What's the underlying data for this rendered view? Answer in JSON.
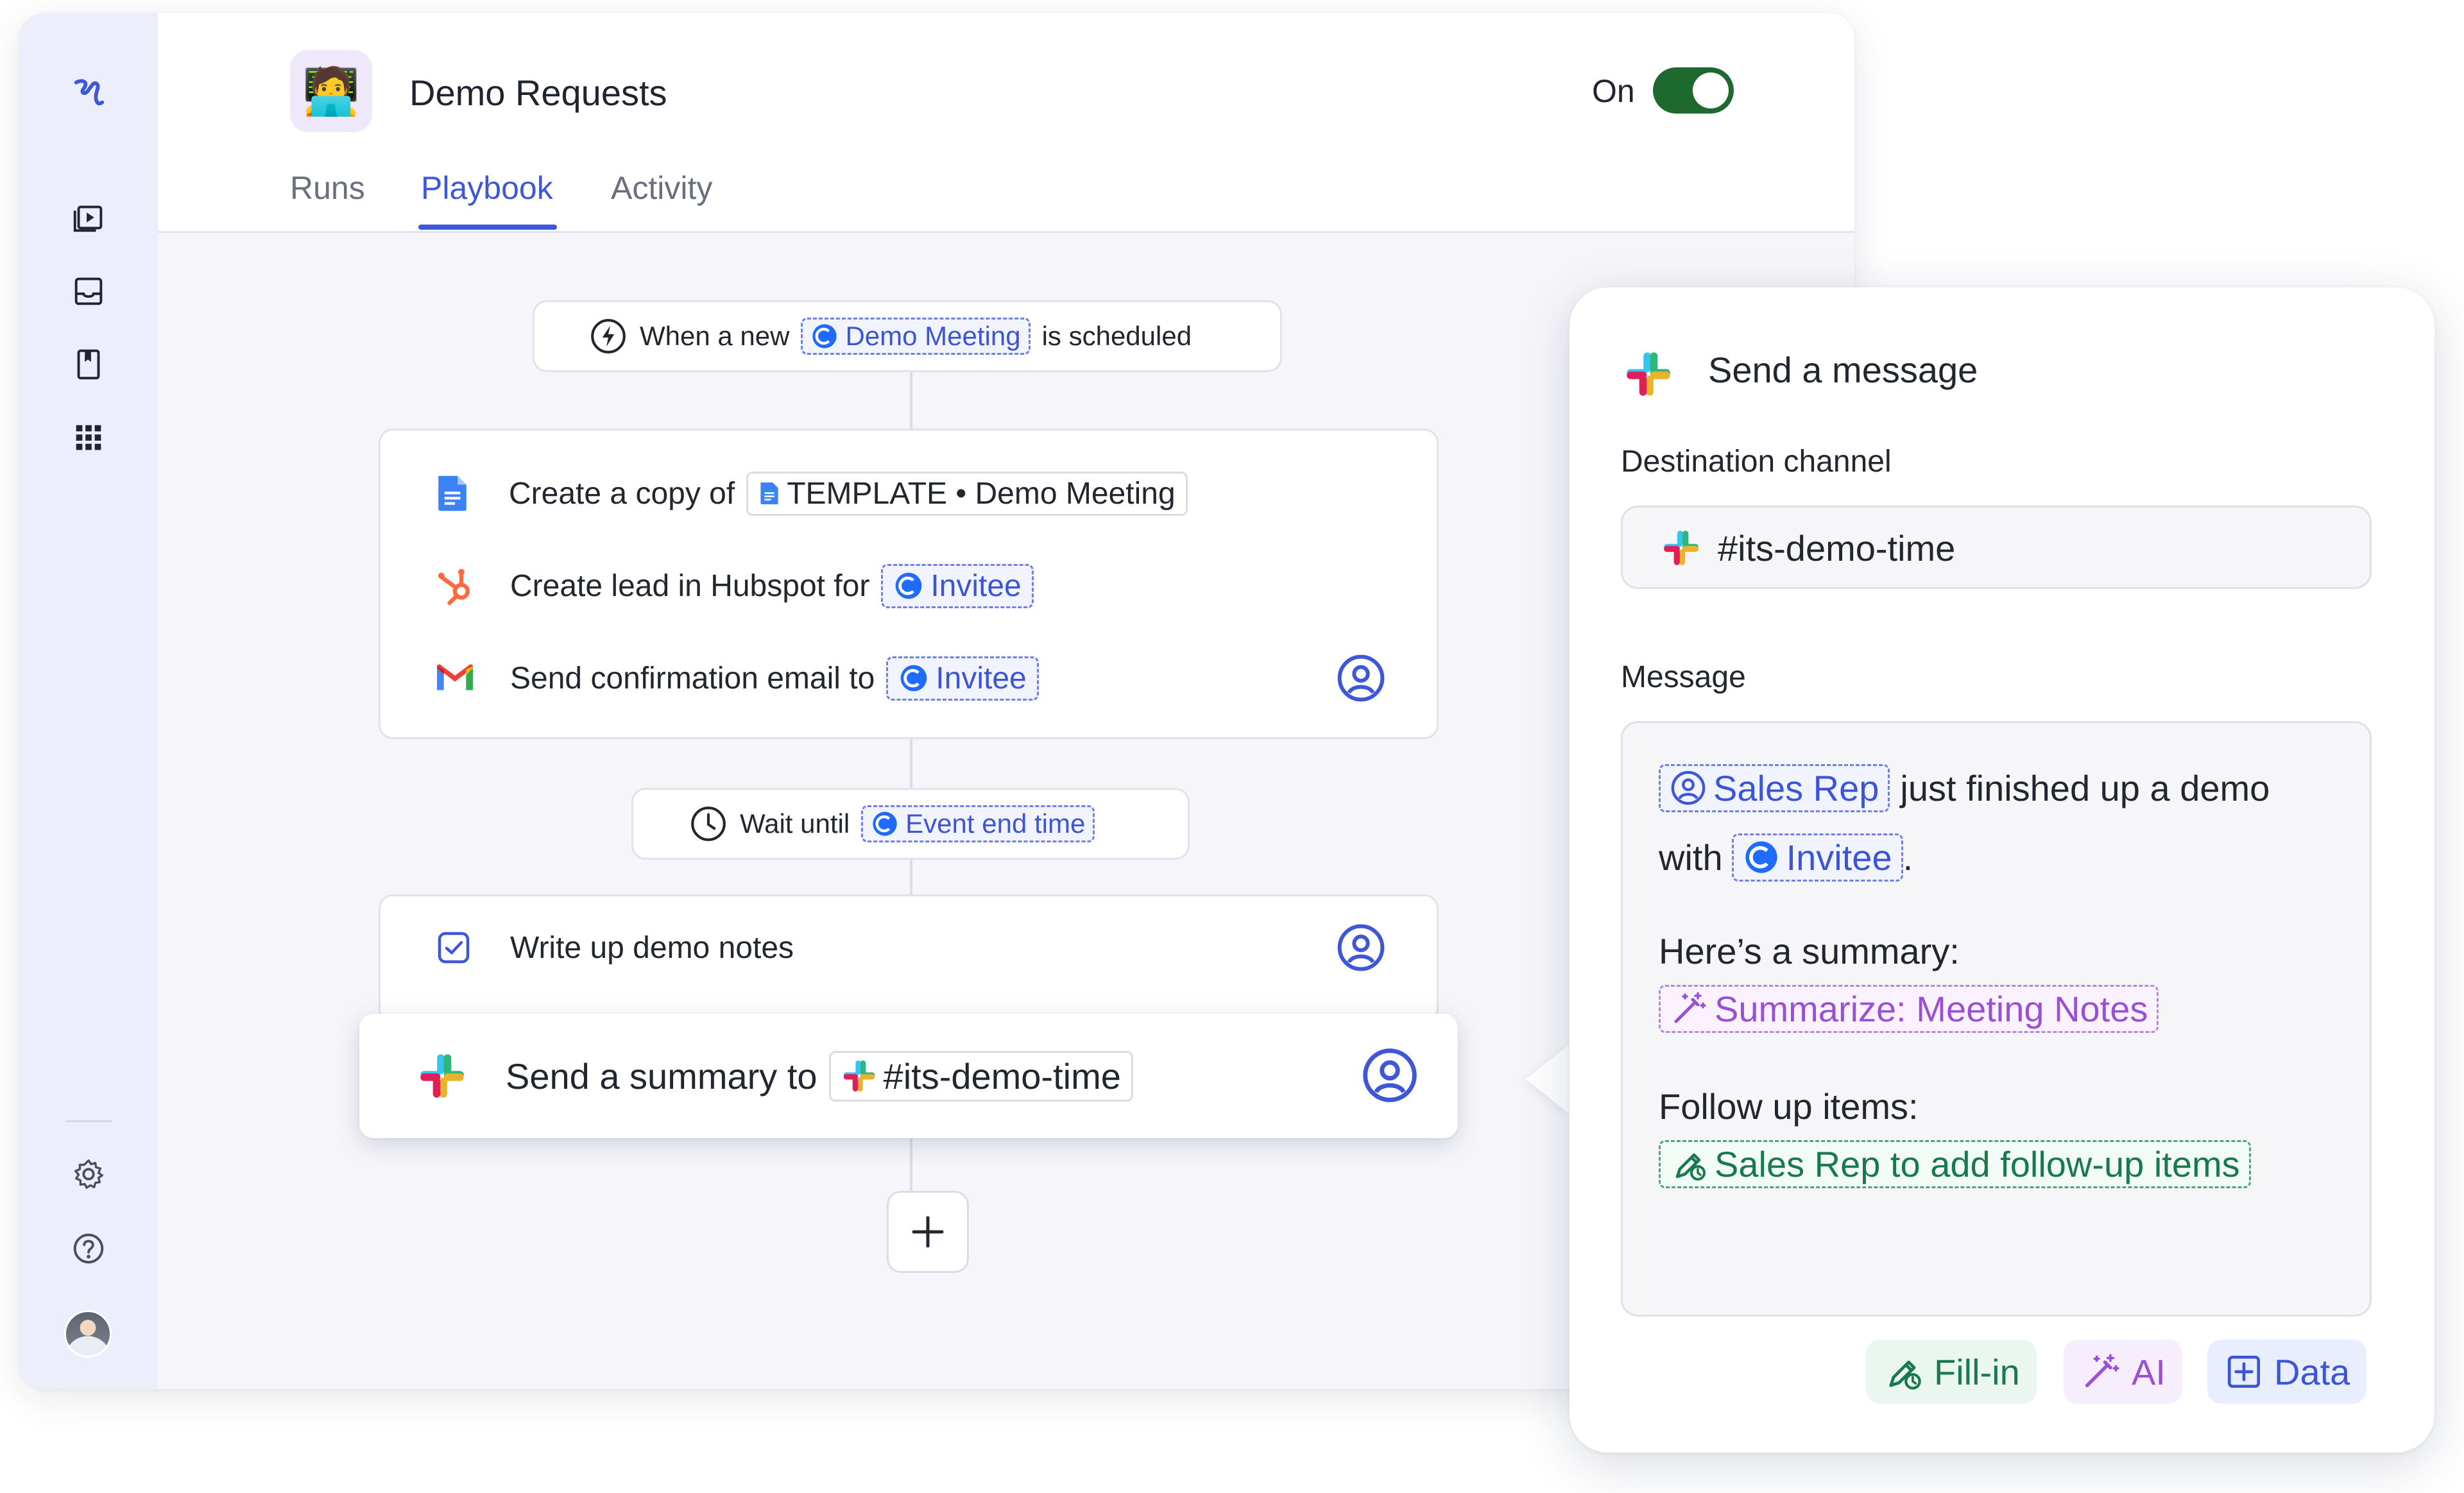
{
  "window": {
    "app_title": "Demo Requests",
    "app_icon": "technologist-emoji",
    "app_emoji": "🧑‍💻",
    "toggle_label": "On",
    "toggle_state": "on",
    "accent_color": "#3e57d8",
    "toggle_color": "#1e6a2e"
  },
  "sidebar": {
    "items": [
      {
        "icon": "logo-icon"
      },
      {
        "icon": "runs-play-icon"
      },
      {
        "icon": "inbox-icon"
      },
      {
        "icon": "book-icon"
      },
      {
        "icon": "apps-grid-icon"
      },
      {
        "icon": "gear-icon"
      },
      {
        "icon": "help-icon"
      },
      {
        "icon": "avatar"
      }
    ]
  },
  "tabs": [
    {
      "label": "Runs",
      "active": false
    },
    {
      "label": "Playbook",
      "active": true
    },
    {
      "label": "Activity",
      "active": false
    }
  ],
  "flow": {
    "trigger": {
      "prefix": "When a new",
      "token": "Demo Meeting",
      "suffix": "is scheduled",
      "icon": "lightning-icon"
    },
    "steps_group_1": [
      {
        "text": "Create a copy of",
        "token": "TEMPLATE • Demo Meeting",
        "icon": "google-docs-icon"
      },
      {
        "text": "Create lead in Hubspot for",
        "token": "Invitee",
        "icon": "hubspot-icon"
      },
      {
        "text": "Send confirmation email to",
        "token": "Invitee",
        "icon": "gmail-icon",
        "assignee": "user-circle-icon"
      }
    ],
    "wait": {
      "text": "Wait until",
      "token": "Event end time",
      "icon": "clock-icon"
    },
    "task": {
      "text": "Write up demo notes",
      "icon": "checkbox-icon",
      "assignee": "user-circle-icon"
    },
    "selected_step": {
      "text": "Send a summary to",
      "token": "#its-demo-time",
      "icon": "slack-icon",
      "assignee": "user-circle-icon"
    },
    "add_label": "+"
  },
  "panel": {
    "title": "Send a message",
    "destination_label": "Destination channel",
    "destination_value": "#its-demo-time",
    "message_label": "Message",
    "message": {
      "line1_token": "Sales Rep",
      "line1_text": "just finished up a demo",
      "line2_text": "with",
      "line2_token": "Invitee",
      "line2_end": ".",
      "summary_heading": "Here’s a summary:",
      "summary_token": "Summarize: Meeting Notes",
      "followup_heading": "Follow up items:",
      "followup_token": "Sales Rep to add follow-up items"
    },
    "actions": [
      {
        "label": "Fill-in",
        "icon": "fill-in-pen-icon",
        "color": "#187a4c"
      },
      {
        "label": "AI",
        "icon": "magic-wand-icon",
        "color": "#9a4fd4"
      },
      {
        "label": "Data",
        "icon": "plus-square-icon",
        "color": "#3b55d6"
      }
    ]
  }
}
